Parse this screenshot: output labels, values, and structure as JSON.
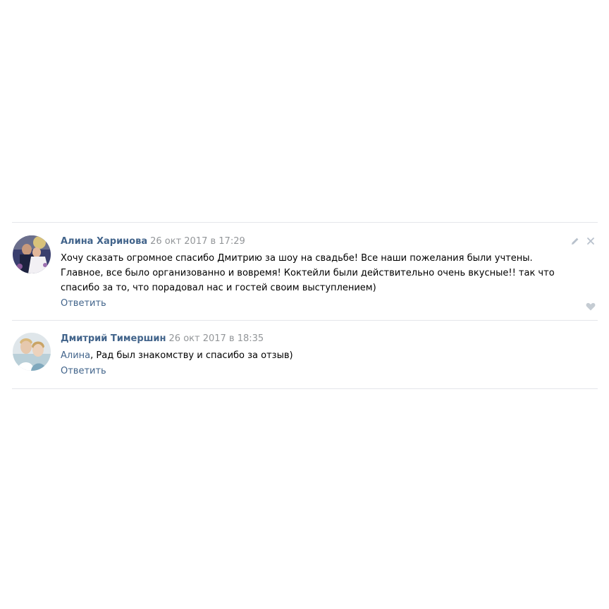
{
  "comments": [
    {
      "author": "Алина Харинова",
      "date": "26 окт 2017 в 17:29",
      "text": "Хочу сказать огромное спасибо Дмитрию за шоу на свадьбе! Все наши пожелания были учтены. Главное, все было организованно и вовремя! Коктейли были действительно очень вкусные!! так что спасибо за то, что порадовал нас и гостей своим выступлением)",
      "reply_label": "Ответить",
      "icons": [
        "pencil-icon",
        "close-icon",
        "heart-icon"
      ]
    },
    {
      "author": "Дмитрий Тимершин",
      "date": "26 окт 2017 в 18:35",
      "mention": "Алина",
      "text": ", Рад был знакомству и спасибо за отзыв)",
      "reply_label": "Ответить"
    }
  ],
  "colors": {
    "link": "#42648b",
    "date": "#939699",
    "divider": "#e4e6ea",
    "icon": "#b8c1cc"
  }
}
